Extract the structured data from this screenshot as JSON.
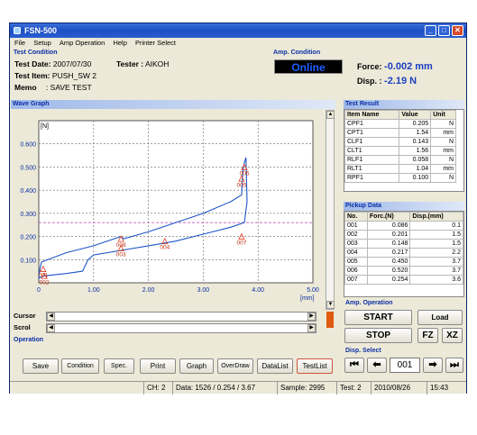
{
  "window": {
    "title": "FSN-500"
  },
  "menu": [
    "File",
    "Setup",
    "Amp Operation",
    "Help",
    "Printer Select"
  ],
  "test_condition": {
    "group_label": "Test Condition",
    "date_label": "Test Date:",
    "date_value": "2007/07/30",
    "tester_label": "Tester :",
    "tester_value": "AIKOH",
    "item_label": "Test Item:",
    "item_value": "PUSH_SW 2",
    "memo_label": "Memo",
    "memo_value": ": SAVE TEST"
  },
  "amp_condition": {
    "group_label": "Amp. Condition",
    "status": "Online",
    "force_label": "Force:",
    "force_value": "-0.002 mm",
    "disp_label": "Disp. :",
    "disp_value": "-2.19  N"
  },
  "wave_graph": {
    "group_label": "Wave Graph",
    "y_unit": "[N]",
    "x_unit": "[mm]",
    "cursor_label": "Cursor",
    "scroll_label": "Scrol"
  },
  "chart_data": {
    "type": "line",
    "xlim": [
      0,
      5
    ],
    "ylim": [
      0,
      0.7
    ],
    "x_ticks": [
      "0",
      "1.00",
      "2.00",
      "3.00",
      "4.00",
      "5.00"
    ],
    "y_ticks": [
      "0.100",
      "0.200",
      "0.300",
      "0.400",
      "0.500",
      "0.600"
    ],
    "threshold": 0.26,
    "series": [
      {
        "points": [
          [
            0,
            0.02
          ],
          [
            0.02,
            0.06
          ],
          [
            0.05,
            0.09
          ],
          [
            0.5,
            0.13
          ],
          [
            1.0,
            0.16
          ],
          [
            1.5,
            0.2
          ],
          [
            1.55,
            0.19
          ],
          [
            2.0,
            0.22
          ],
          [
            2.5,
            0.26
          ],
          [
            3.0,
            0.3
          ],
          [
            3.5,
            0.35
          ],
          [
            3.7,
            0.38
          ],
          [
            3.72,
            0.48
          ],
          [
            3.75,
            0.52
          ],
          [
            3.78,
            0.54
          ]
        ]
      },
      {
        "points": [
          [
            3.78,
            0.54
          ],
          [
            3.8,
            0.35
          ],
          [
            3.75,
            0.26
          ],
          [
            3.5,
            0.24
          ],
          [
            3.0,
            0.21
          ],
          [
            2.5,
            0.18
          ],
          [
            2.0,
            0.16
          ],
          [
            1.5,
            0.14
          ],
          [
            1.0,
            0.12
          ],
          [
            0.9,
            0.1
          ],
          [
            0.8,
            0.05
          ],
          [
            0.5,
            0.04
          ],
          [
            0.1,
            0.03
          ],
          [
            0.0,
            0.02
          ]
        ]
      }
    ],
    "markers": [
      {
        "label": "001",
        "x": 0.08,
        "y": 0.06
      },
      {
        "label": "002",
        "x": 0.1,
        "y": 0.03
      },
      {
        "label": "003",
        "x": 1.5,
        "y": 0.15
      },
      {
        "label": "004",
        "x": 2.3,
        "y": 0.18
      },
      {
        "label": "005",
        "x": 3.7,
        "y": 0.45
      },
      {
        "label": "006",
        "x": 3.75,
        "y": 0.5
      },
      {
        "label": "007",
        "x": 3.7,
        "y": 0.2
      },
      {
        "label": "008",
        "x": 1.5,
        "y": 0.19
      }
    ]
  },
  "test_result": {
    "group_label": "Test Result",
    "headers": [
      "Item Name",
      "Value",
      "Unit"
    ],
    "rows": [
      [
        "CPF1",
        "0.205",
        "N"
      ],
      [
        "CPT1",
        "1.54",
        "mm"
      ],
      [
        "CLF1",
        "0.143",
        "N"
      ],
      [
        "CLT1",
        "1.56",
        "mm"
      ],
      [
        "RLF1",
        "0.058",
        "N"
      ],
      [
        "RLT1",
        "1.04",
        "mm"
      ],
      [
        "RPF1",
        "0.100",
        "N"
      ]
    ]
  },
  "pickup_data": {
    "group_label": "Pickup Data",
    "headers": [
      "No.",
      "Forc.(N)",
      "Disp.(mm)"
    ],
    "rows": [
      [
        "001",
        "0.086",
        "0.1"
      ],
      [
        "002",
        "0.201",
        "1.5"
      ],
      [
        "003",
        "0.148",
        "1.5"
      ],
      [
        "004",
        "0.217",
        "2.2"
      ],
      [
        "005",
        "0.450",
        "3.7"
      ],
      [
        "006",
        "0.520",
        "3.7"
      ],
      [
        "007",
        "0.254",
        "3.6"
      ]
    ]
  },
  "amp_operation": {
    "group_label": "Amp. Operation",
    "start": "START",
    "load": "Load",
    "stop": "STOP",
    "fz": "FZ",
    "xz": "XZ"
  },
  "disp_select": {
    "group_label": "Disp. Select",
    "value": "001"
  },
  "operation": {
    "group_label": "Operation",
    "buttons": [
      "Save",
      "Condition",
      "Spec.",
      "Print",
      "Graph",
      "OverDraw",
      "DataList",
      "TestList"
    ]
  },
  "status": {
    "ch": "CH: 2",
    "data": "Data: 1526 / 0.254 / 3.67",
    "sample": "Sample: 2995",
    "test": "Test:  2",
    "date": "2010/08/26",
    "time": "15:43"
  }
}
